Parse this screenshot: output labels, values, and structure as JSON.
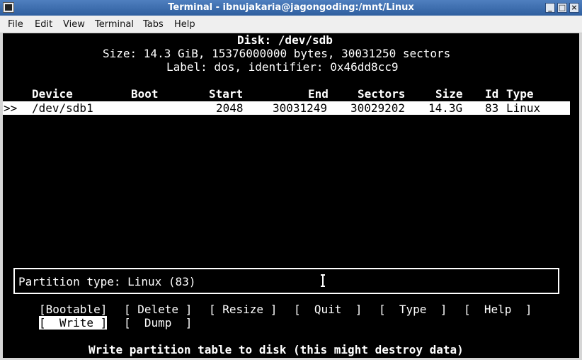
{
  "window": {
    "title": "Terminal - ibnujakaria@jagongoding:/mnt/Linux"
  },
  "menu": [
    "File",
    "Edit",
    "View",
    "Terminal",
    "Tabs",
    "Help"
  ],
  "disk": {
    "title": "Disk: /dev/sdb",
    "size_line": "Size: 14.3 GiB, 15376000000 bytes, 30031250 sectors",
    "label_line": "Label: dos, identifier: 0x46dd8cc9"
  },
  "table": {
    "headers": {
      "device": "Device",
      "boot": "Boot",
      "start": "Start",
      "end": "End",
      "sectors": "Sectors",
      "size": "Size",
      "id": "Id",
      "type": "Type"
    },
    "rows": [
      {
        "marker": ">>",
        "device": "/dev/sdb1",
        "boot": "",
        "start": "2048",
        "end": "30031249",
        "sectors": "30029202",
        "size": "14.3G",
        "id": "83",
        "type": "Linux"
      }
    ]
  },
  "info": "Partition type: Linux (83)",
  "actions": {
    "bootable": "[Bootable]",
    "delete": "[ Delete ]",
    "resize": "[ Resize ]",
    "quit": "[  Quit  ]",
    "type": "[  Type  ]",
    "help": "[  Help  ]",
    "write": "[  Write ]",
    "dump": "[  Dump  ]"
  },
  "hint": "Write partition table to disk (this might destroy data)",
  "colors": {
    "titlebar": "#3d6dae",
    "terminal_bg": "#000000",
    "terminal_fg": "#ffffff"
  }
}
